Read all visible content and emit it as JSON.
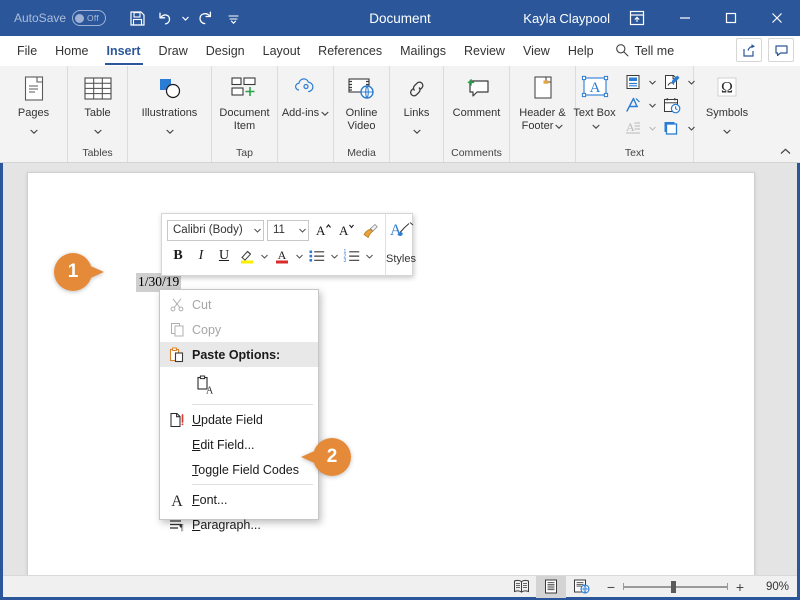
{
  "titlebar": {
    "autosave_label": "AutoSave",
    "autosave_state": "Off",
    "document_title": "Document",
    "user_name": "Kayla Claypool",
    "qat": [
      {
        "name": "save",
        "label": "Save"
      },
      {
        "name": "undo",
        "label": "Undo"
      },
      {
        "name": "redo",
        "label": "Redo"
      },
      {
        "name": "customize-qat",
        "label": "Customize Quick Access Toolbar"
      }
    ],
    "window_controls": [
      {
        "name": "minimize",
        "label": "Minimize"
      },
      {
        "name": "restore",
        "label": "Restore Down"
      },
      {
        "name": "close",
        "label": "Close"
      }
    ]
  },
  "tabs": [
    {
      "label": "File",
      "active": false
    },
    {
      "label": "Home",
      "active": false
    },
    {
      "label": "Insert",
      "active": true
    },
    {
      "label": "Draw",
      "active": false
    },
    {
      "label": "Design",
      "active": false
    },
    {
      "label": "Layout",
      "active": false
    },
    {
      "label": "References",
      "active": false
    },
    {
      "label": "Mailings",
      "active": false
    },
    {
      "label": "Review",
      "active": false
    },
    {
      "label": "View",
      "active": false
    },
    {
      "label": "Help",
      "active": false
    }
  ],
  "tellme": {
    "label": "Tell me"
  },
  "tabbar_right": [
    {
      "name": "share-button",
      "label": "Share"
    },
    {
      "name": "comments-button",
      "label": "Comments"
    }
  ],
  "ribbon": {
    "groups": [
      {
        "name": "pages",
        "label": "",
        "buttons": [
          {
            "label": "Pages",
            "caret": true
          }
        ]
      },
      {
        "name": "tables",
        "label": "Tables",
        "buttons": [
          {
            "label": "Table",
            "caret": true
          }
        ]
      },
      {
        "name": "illustrations",
        "label": "",
        "buttons": [
          {
            "label": "Illustrations",
            "caret": true
          }
        ]
      },
      {
        "name": "tap",
        "label": "Tap",
        "buttons": [
          {
            "label": "Document Item",
            "caret": false
          }
        ]
      },
      {
        "name": "add-ins",
        "label": "",
        "buttons": [
          {
            "label": "Add-ins",
            "caret": true
          }
        ]
      },
      {
        "name": "media",
        "label": "Media",
        "buttons": [
          {
            "label": "Online Video",
            "caret": false
          }
        ]
      },
      {
        "name": "links",
        "label": "",
        "buttons": [
          {
            "label": "Links",
            "caret": true
          }
        ]
      },
      {
        "name": "comments",
        "label": "Comments",
        "buttons": [
          {
            "label": "Comment",
            "caret": false
          }
        ]
      },
      {
        "name": "header-footer",
        "label": "",
        "buttons": [
          {
            "label": "Header & Footer",
            "caret": true
          }
        ]
      },
      {
        "name": "text",
        "label": "Text",
        "buttons": [
          {
            "label": "Text Box",
            "caret": true
          }
        ]
      },
      {
        "name": "symbols",
        "label": "",
        "buttons": [
          {
            "label": "Symbols",
            "caret": true
          }
        ]
      }
    ],
    "text_group_small": [
      {
        "name": "quick-parts",
        "label": "Quick Parts"
      },
      {
        "name": "signature-line",
        "label": "Signature Line"
      },
      {
        "name": "wordart",
        "label": "WordArt"
      },
      {
        "name": "date-time",
        "label": "Date & Time"
      },
      {
        "name": "drop-cap",
        "label": "Drop Cap"
      },
      {
        "name": "object",
        "label": "Object"
      }
    ],
    "collapse_label": "Collapse the Ribbon"
  },
  "document": {
    "field_text": "1/30/19"
  },
  "minitoolbar": {
    "font_name": "Calibri (Body)",
    "font_size": "11",
    "buttons": [
      {
        "name": "grow-font",
        "label": "Grow Font"
      },
      {
        "name": "shrink-font",
        "label": "Shrink Font"
      },
      {
        "name": "format-painter",
        "label": "Format Painter"
      },
      {
        "name": "bold",
        "label": "B"
      },
      {
        "name": "italic",
        "label": "I"
      },
      {
        "name": "underline",
        "label": "U"
      },
      {
        "name": "text-highlight",
        "label": "Text Highlight Color"
      },
      {
        "name": "font-color",
        "label": "Font Color"
      },
      {
        "name": "bullets",
        "label": "Bullets"
      },
      {
        "name": "numbering",
        "label": "Numbering"
      }
    ],
    "styles_label": "Styles"
  },
  "contextmenu": {
    "items": [
      {
        "name": "cut",
        "label": "Cut",
        "underline": "t",
        "disabled": true,
        "icon": "scissors-icon"
      },
      {
        "name": "copy",
        "label": "Copy",
        "underline": "C",
        "disabled": true,
        "icon": "copy-icon"
      },
      {
        "name": "paste-options",
        "label": "Paste Options:",
        "header": true,
        "disabled": false,
        "icon": "clipboard-icon"
      }
    ],
    "paste_option": {
      "name": "keep-text-only",
      "label": "Keep Text Only"
    },
    "field_items": [
      {
        "name": "update-field",
        "label": "Update Field",
        "underline": "U",
        "icon": "update-field-icon"
      },
      {
        "name": "edit-field",
        "label": "Edit Field...",
        "underline": "E",
        "icon": "none"
      },
      {
        "name": "toggle-field-codes",
        "label": "Toggle Field Codes",
        "underline": "T",
        "icon": "none"
      }
    ],
    "format_items": [
      {
        "name": "font",
        "label": "Font...",
        "underline": "F",
        "icon": "font-a-icon"
      },
      {
        "name": "paragraph",
        "label": "Paragraph...",
        "underline": "P",
        "icon": "paragraph-icon"
      }
    ]
  },
  "callouts": [
    {
      "name": "callout-1",
      "number": "1",
      "points": "right"
    },
    {
      "name": "callout-2",
      "number": "2",
      "points": "left"
    }
  ],
  "statusbar": {
    "views": [
      {
        "name": "read-mode",
        "label": "Read Mode",
        "active": false
      },
      {
        "name": "print-layout",
        "label": "Print Layout",
        "active": true
      },
      {
        "name": "web-layout",
        "label": "Web Layout",
        "active": false
      }
    ],
    "zoom_out_label": "−",
    "zoom_in_label": "+",
    "zoom_value": "90%"
  },
  "colors": {
    "title_bar": "#2b579a",
    "accent": "#2b579a",
    "callout": "#e58a38",
    "ribbon_bg": "#f3f3f3",
    "doc_bg": "#e4e4e4",
    "field_shading": "#cfcfcf"
  }
}
